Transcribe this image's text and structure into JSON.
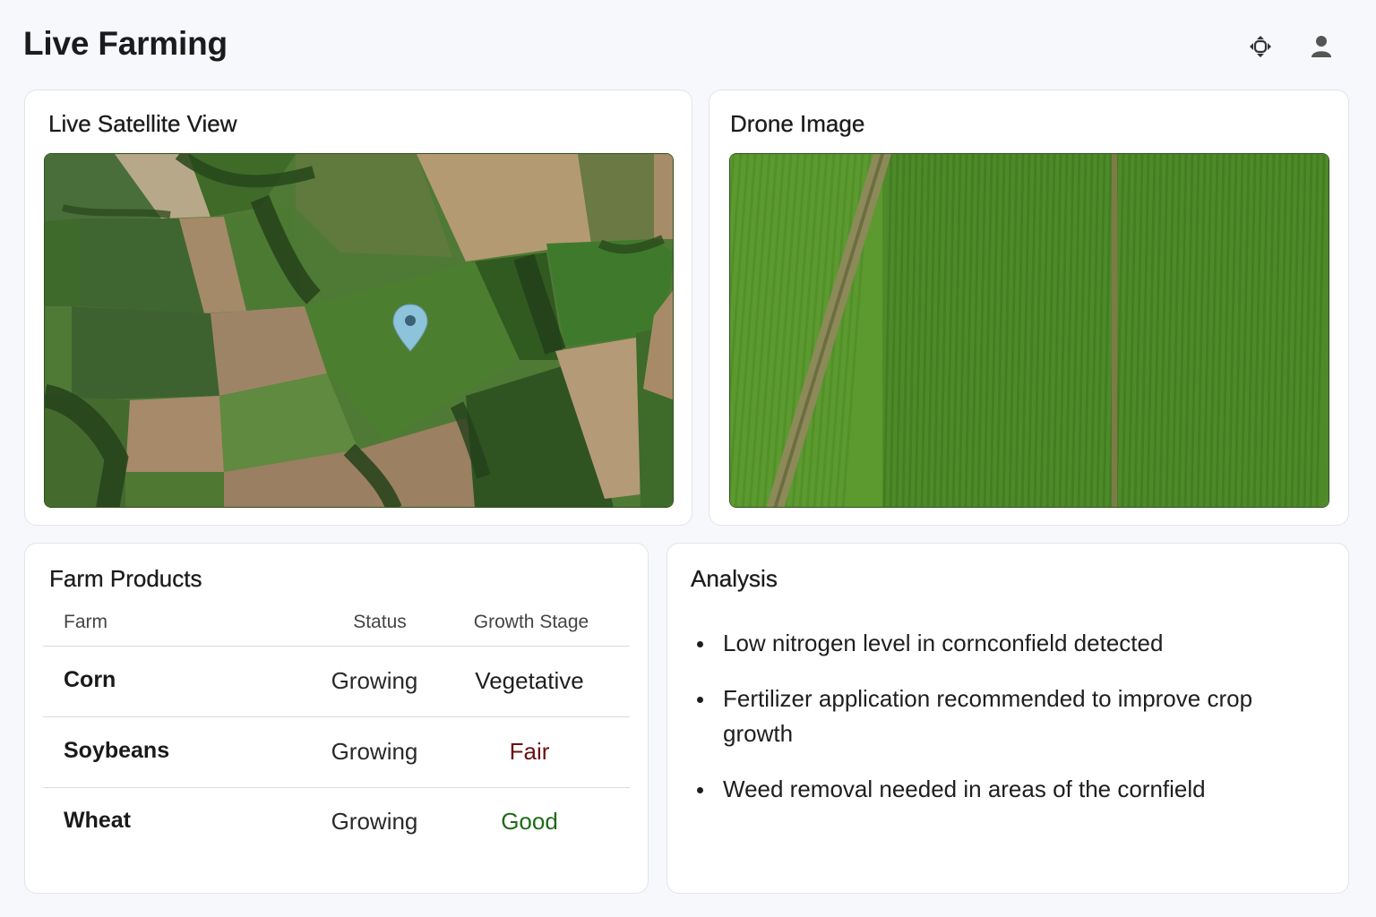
{
  "app": {
    "title": "Live Farming"
  },
  "header": {
    "icons": [
      "drone-move-icon",
      "user-icon"
    ]
  },
  "satellite": {
    "title": "Live Satellite View",
    "marker_icon": "location-pin-icon"
  },
  "drone": {
    "title": "Drone Image"
  },
  "products": {
    "title": "Farm Products",
    "columns": [
      "Farm",
      "Status",
      "Growth Stage"
    ],
    "rows": [
      {
        "farm": "Corn",
        "status": "Growing",
        "stage": "Vegetative",
        "stage_color": "#1e1e1e"
      },
      {
        "farm": "Soybeans",
        "status": "Growing",
        "stage": "Fair",
        "stage_color": "#6b1010"
      },
      {
        "farm": "Wheat",
        "status": "Growing",
        "stage": "Good",
        "stage_color": "#1f6b1a"
      }
    ]
  },
  "analysis": {
    "title": "Analysis",
    "items": [
      "Low nitrogen level in cornconfield detected",
      "Fertilizer application recommended to improve crop growth",
      "Weed removal needed in areas of the cornfield"
    ]
  }
}
